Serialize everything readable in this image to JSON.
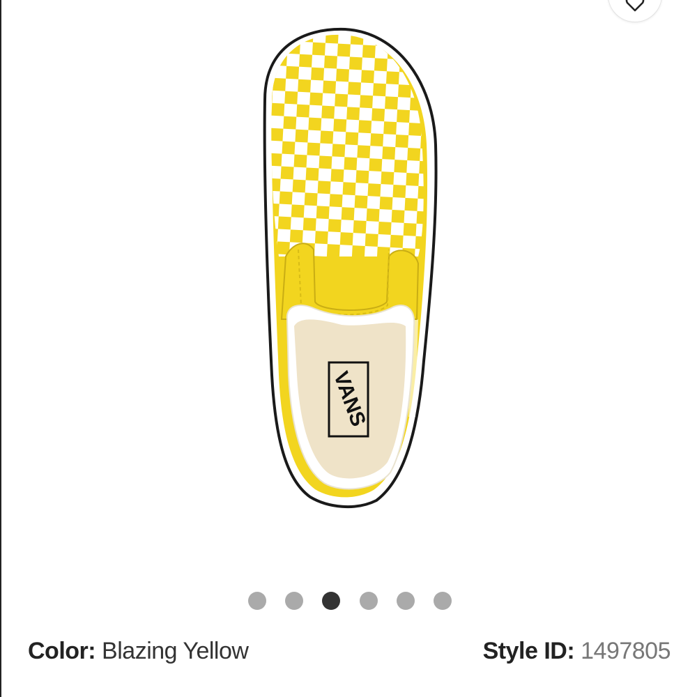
{
  "product": {
    "color_label": "Color:",
    "color_value": "Blazing Yellow",
    "style_label": "Style ID:",
    "style_value": "1497805",
    "image_brand_logo": "VANS",
    "image_alt": "Vans Slip On Checkerboard Skate Shoe - Blazing Yellow top view"
  },
  "carousel": {
    "count": 6,
    "active_index": 2
  },
  "icons": {
    "favorite": "heart-icon"
  },
  "colors": {
    "shoe_yellow": "#f2d51f",
    "check_white": "#ffffff",
    "insole": "#efe3c8",
    "dot_inactive": "#aaaaaa",
    "dot_active": "#333333"
  }
}
